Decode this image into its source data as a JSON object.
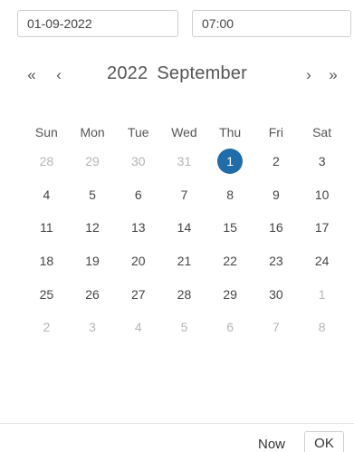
{
  "inputs": {
    "date_value": "01-09-2022",
    "time_value": "07:00"
  },
  "header": {
    "prev_year_icon": "«",
    "prev_month_icon": "‹",
    "year": "2022",
    "month": "September",
    "next_month_icon": "›",
    "next_year_icon": "»"
  },
  "weekdays": [
    "Sun",
    "Mon",
    "Tue",
    "Wed",
    "Thu",
    "Fri",
    "Sat"
  ],
  "weeks": [
    [
      {
        "d": "28",
        "m": true
      },
      {
        "d": "29",
        "m": true
      },
      {
        "d": "30",
        "m": true
      },
      {
        "d": "31",
        "m": true
      },
      {
        "d": "1",
        "sel": true
      },
      {
        "d": "2"
      },
      {
        "d": "3"
      }
    ],
    [
      {
        "d": "4"
      },
      {
        "d": "5"
      },
      {
        "d": "6"
      },
      {
        "d": "7"
      },
      {
        "d": "8"
      },
      {
        "d": "9"
      },
      {
        "d": "10"
      }
    ],
    [
      {
        "d": "11"
      },
      {
        "d": "12"
      },
      {
        "d": "13"
      },
      {
        "d": "14"
      },
      {
        "d": "15"
      },
      {
        "d": "16"
      },
      {
        "d": "17"
      }
    ],
    [
      {
        "d": "18"
      },
      {
        "d": "19"
      },
      {
        "d": "20"
      },
      {
        "d": "21"
      },
      {
        "d": "22"
      },
      {
        "d": "23"
      },
      {
        "d": "24"
      }
    ],
    [
      {
        "d": "25"
      },
      {
        "d": "26"
      },
      {
        "d": "27"
      },
      {
        "d": "28"
      },
      {
        "d": "29"
      },
      {
        "d": "30"
      },
      {
        "d": "1",
        "m": true
      }
    ],
    [
      {
        "d": "2",
        "m": true
      },
      {
        "d": "3",
        "m": true
      },
      {
        "d": "4",
        "m": true
      },
      {
        "d": "5",
        "m": true
      },
      {
        "d": "6",
        "m": true
      },
      {
        "d": "7",
        "m": true
      },
      {
        "d": "8",
        "m": true
      }
    ]
  ],
  "footer": {
    "now_label": "Now",
    "ok_label": "OK"
  },
  "colors": {
    "selected": "#1f6ca8",
    "muted_text": "#b5b5b5"
  }
}
